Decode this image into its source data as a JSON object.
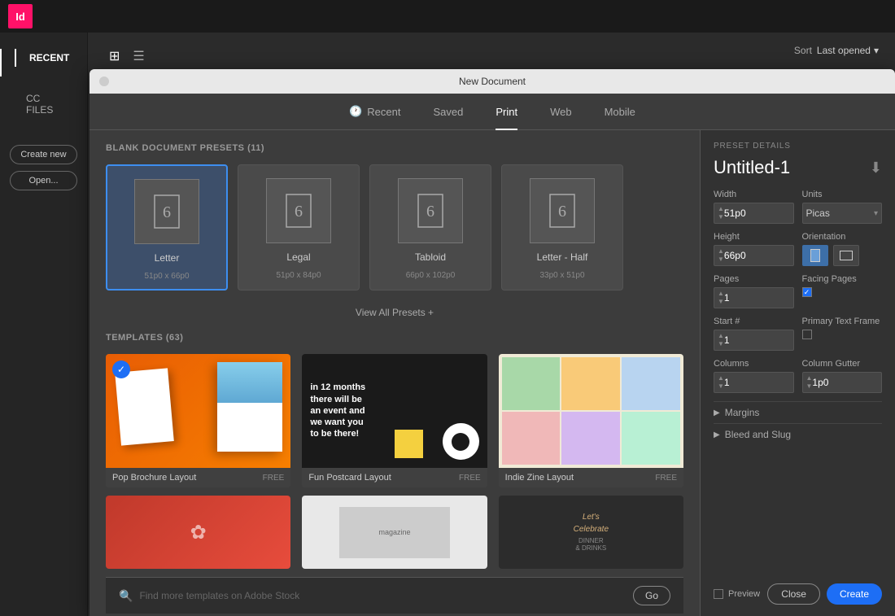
{
  "app": {
    "icon_label": "Id"
  },
  "top_bar": {
    "sort_label": "Sort",
    "sort_value": "Last opened"
  },
  "sidebar": {
    "recent_label": "RECENT",
    "cc_files_label": "CC FILES",
    "create_new_label": "Create new",
    "open_label": "Open..."
  },
  "dialog": {
    "title": "New Document",
    "close_btn_title": "●",
    "tabs": [
      {
        "label": "Recent",
        "icon": "clock"
      },
      {
        "label": "Saved",
        "icon": ""
      },
      {
        "label": "Print",
        "active": true
      },
      {
        "label": "Web",
        "icon": ""
      },
      {
        "label": "Mobile",
        "icon": ""
      }
    ]
  },
  "presets": {
    "section_label": "BLANK DOCUMENT PRESETS",
    "count": "(11)",
    "items": [
      {
        "name": "Letter",
        "size": "51p0 x 66p0",
        "selected": true
      },
      {
        "name": "Legal",
        "size": "51p0 x 84p0"
      },
      {
        "name": "Tabloid",
        "size": "66p0 x 102p0"
      },
      {
        "name": "Letter - Half",
        "size": "33p0 x 51p0"
      }
    ],
    "view_all_label": "View All Presets +"
  },
  "templates": {
    "section_label": "TEMPLATES",
    "count": "(63)",
    "items": [
      {
        "name": "Pop Brochure Layout",
        "badge": "FREE",
        "selected": true,
        "type": "orange"
      },
      {
        "name": "Fun Postcard Layout",
        "badge": "FREE",
        "type": "dark"
      },
      {
        "name": "Indie Zine Layout",
        "badge": "FREE",
        "type": "light"
      }
    ],
    "bottom_items": [
      {
        "name": "",
        "type": "flowers"
      },
      {
        "name": "",
        "type": "magazine"
      },
      {
        "name": "",
        "type": "dinner"
      }
    ]
  },
  "search": {
    "placeholder": "Find more templates on Adobe Stock",
    "go_label": "Go"
  },
  "preset_details": {
    "section_label": "PRESET DETAILS",
    "doc_title": "Untitled-1",
    "save_icon": "💾",
    "width_label": "Width",
    "width_value": "51p0",
    "units_label": "Units",
    "units_value": "Picas",
    "height_label": "Height",
    "height_value": "66p0",
    "orientation_label": "Orientation",
    "pages_label": "Pages",
    "pages_value": "1",
    "facing_pages_label": "Facing Pages",
    "facing_pages_checked": true,
    "start_hash_label": "Start #",
    "start_hash_value": "1",
    "primary_text_frame_label": "Primary Text Frame",
    "primary_text_frame_checked": false,
    "columns_label": "Columns",
    "columns_value": "1",
    "column_gutter_label": "Column Gutter",
    "column_gutter_value": "1p0",
    "margins_label": "Margins",
    "bleed_slug_label": "Bleed and Slug"
  },
  "footer": {
    "preview_label": "Preview",
    "close_label": "Close",
    "create_label": "Create"
  }
}
